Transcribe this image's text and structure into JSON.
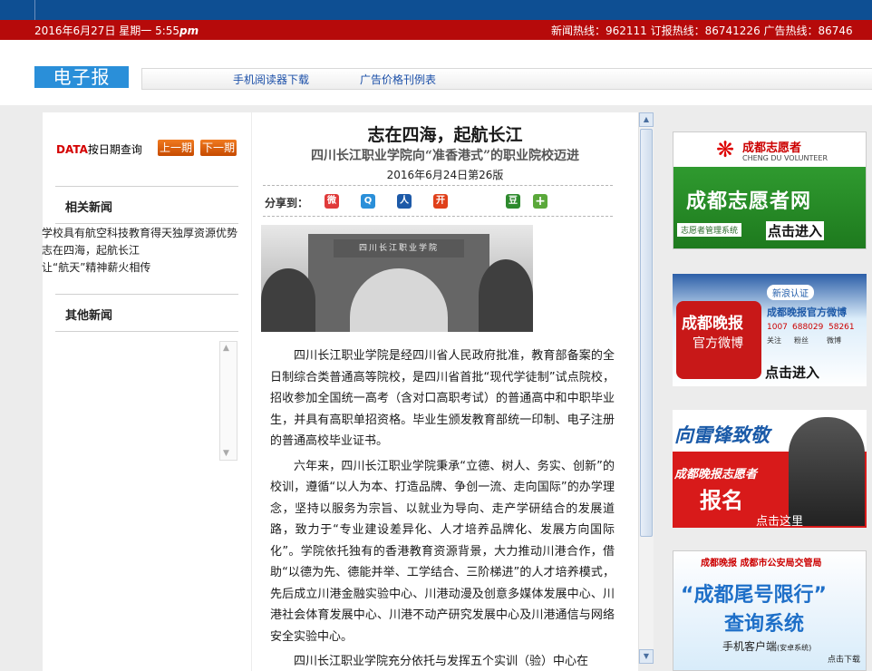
{
  "topbar": {
    "date": "2016年6月27日 星期一 5:55",
    "ampm": "pm",
    "hotline": "新闻热线：962111 订报热线：86741226 广告热线：86746"
  },
  "header": {
    "logo": "电子报",
    "nav": [
      "手机阅读器下载",
      "广告价格刊例表"
    ]
  },
  "left": {
    "data_label": "DATA",
    "query_label": "按日期查询",
    "prev_button": "上一期",
    "next_button": "下一期",
    "related_title": "相关新闻",
    "related_items": [
      "学校具有航空科技教育得天独厚资源优势",
      "志在四海，起航长江",
      "让“航天”精神薪火相传"
    ],
    "other_title": "其他新闻"
  },
  "article": {
    "title": "志在四海，起航长江",
    "subtitle": "四川长江职业学院向“准香港式”的职业院校迈进",
    "date": "2016年6月24日第26版",
    "share_label": "分享到：",
    "share_icons": [
      "weibo-icon",
      "qq-icon",
      "renren-icon",
      "kaixin-icon",
      "douban-icon",
      "more-icon"
    ],
    "photo_sign": "四川长江职业学院",
    "paragraphs": [
      "四川长江职业学院是经四川省人民政府批准，教育部备案的全日制综合类普通高等院校，是四川省首批“现代学徒制”试点院校，招收参加全国统一高考（含对口高职考试）的普通高中和中职毕业生，并具有高职单招资格。毕业生颁发教育部统一印制、电子注册的普通高校毕业证书。",
      "六年来，四川长江职业学院秉承“立德、树人、务实、创新”的校训，遵循“以人为本、打造品牌、争创一流、走向国际”的办学理念，坚持以服务为宗旨、以就业为导向、走产学研结合的发展道路，致力于“专业建设差异化、人才培养品牌化、发展方向国际化”。学院依托独有的香港教育资源背景，大力推动川港合作，借助“以德为先、德能并举、工学结合、三阶梯进”的人才培养模式，先后成立川港金融实验中心、川港动漫及创意多媒体发展中心、川港社会体育发展中心、川港不动产研究发展中心及川港通信与网络安全实验中心。",
      "四川长江职业学院充分依托与发挥五个实训（验）中心在"
    ]
  },
  "ads": {
    "volunteer": {
      "org": "成都志愿者",
      "org_en": "CHENG DU VOLUNTEER",
      "big": "成都志愿者网",
      "system": "志愿者管理系统",
      "cta": "点击进入"
    },
    "weibo": {
      "brand": "成都晚报",
      "sub": "官方微博",
      "verified": "新浪认证",
      "account": "成都晚报官方微博",
      "stats": [
        "1007",
        "688029",
        "58261"
      ],
      "stat_labels": [
        "关注",
        "粉丝",
        "微博"
      ],
      "cta": "点击进入"
    },
    "leifeng": {
      "top": "向雷锋致敬",
      "mid": "成都晚报志愿者",
      "big": "报名",
      "cta": "点击这里"
    },
    "plate": {
      "header": "成都晚报  成都市公安局交管局",
      "big1": "“成都尾号限行”",
      "big2": "查询系统",
      "sub": "手机客户端",
      "sub2": "(安卓系统)",
      "cta": "点击下载"
    }
  },
  "colors": {
    "top_blue": "#0e4f93",
    "red_bar": "#b60a0a",
    "logo_blue": "#2a8fd9",
    "link_blue": "#1b4fa8",
    "orange_button": "#e06010"
  }
}
